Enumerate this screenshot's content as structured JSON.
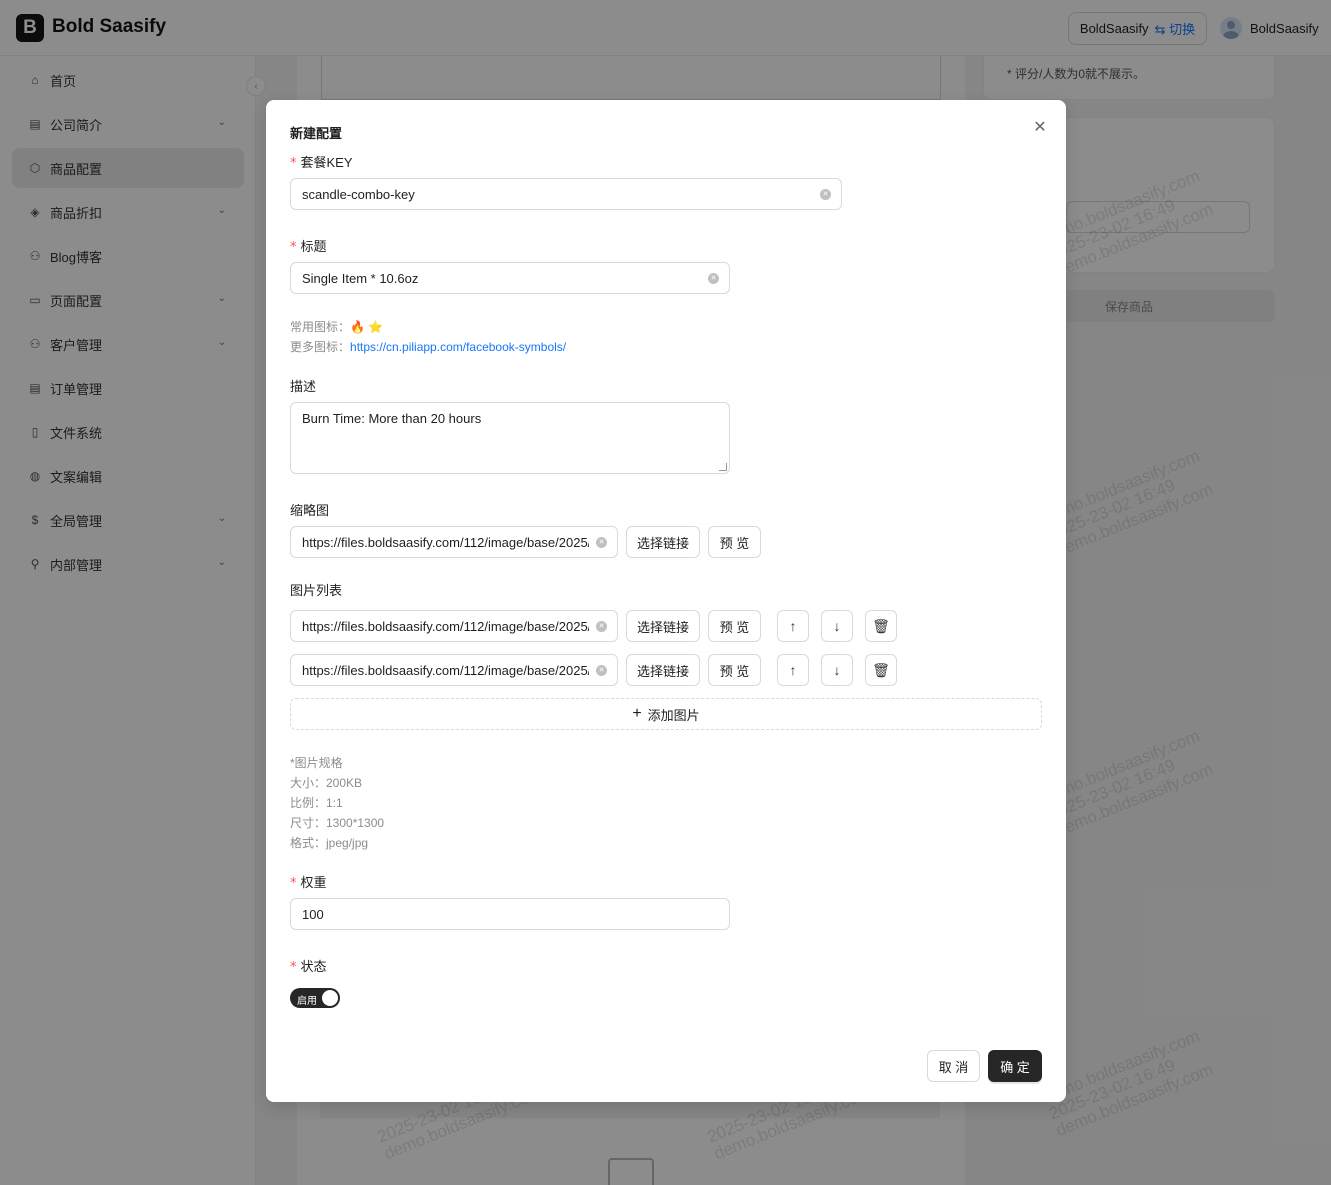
{
  "header": {
    "logo_letter": "B",
    "brand": "Bold Saasify",
    "tenant": "BoldSaasify",
    "switch_label": "⇆ 切换",
    "username": "BoldSaasify"
  },
  "sidebar": {
    "items": [
      {
        "label": "首页",
        "icon": "home-icon"
      },
      {
        "label": "公司简介",
        "icon": "building-icon"
      },
      {
        "label": "商品配置",
        "icon": "box-icon"
      },
      {
        "label": "商品折扣",
        "icon": "tag-icon"
      },
      {
        "label": "Blog博客",
        "icon": "users-icon"
      },
      {
        "label": "页面配置",
        "icon": "monitor-icon"
      },
      {
        "label": "客户管理",
        "icon": "customers-icon"
      },
      {
        "label": "订单管理",
        "icon": "order-icon"
      },
      {
        "label": "文件系统",
        "icon": "file-icon"
      },
      {
        "label": "文案编辑",
        "icon": "globe-icon"
      },
      {
        "label": "全局管理",
        "icon": "dollar-icon"
      },
      {
        "label": "内部管理",
        "icon": "user-icon"
      }
    ]
  },
  "background": {
    "rating_note": "* 评分/人数为0就不展示。",
    "save_product": "保存商品",
    "watermark_line1": "demo.boldsaasify.com",
    "watermark_line2": "2025-23-02 16:49",
    "watermark_line3": "demo.boldsaasify.com"
  },
  "modal": {
    "title": "新建配置",
    "fields": {
      "combo_key": {
        "label": "套餐KEY",
        "value": "scandle-combo-key"
      },
      "title": {
        "label": "标题",
        "value": "Single Item * 10.6oz"
      },
      "common_icons_label": "常用图标：",
      "common_icons": "🔥 ⭐",
      "more_icons_label": "更多图标：",
      "more_icons_link": "https://cn.piliapp.com/facebook-symbols/",
      "description": {
        "label": "描述",
        "value": "Burn Time: More than 20 hours"
      },
      "thumbnail": {
        "label": "缩略图",
        "value": "https://files.boldsaasify.com/112/image/base/2025/2"
      },
      "image_list": {
        "label": "图片列表",
        "items": [
          {
            "value": "https://files.boldsaasify.com/112/image/base/2025/2"
          },
          {
            "value": "https://files.boldsaasify.com/112/image/base/2025/2"
          }
        ],
        "add_label": "添加图片"
      },
      "spec": {
        "title": "*图片规格",
        "size": "大小：200KB",
        "ratio": "比例：1:1",
        "dimensions": "尺寸：1300*1300",
        "format": "格式：jpeg/jpg"
      },
      "weight": {
        "label": "权重",
        "value": "100"
      },
      "status": {
        "label": "状态",
        "switch_text": "启用",
        "enabled": true
      }
    },
    "buttons": {
      "select_link": "选择链接",
      "preview": "预 览",
      "cancel": "取 消",
      "ok": "确 定"
    }
  }
}
